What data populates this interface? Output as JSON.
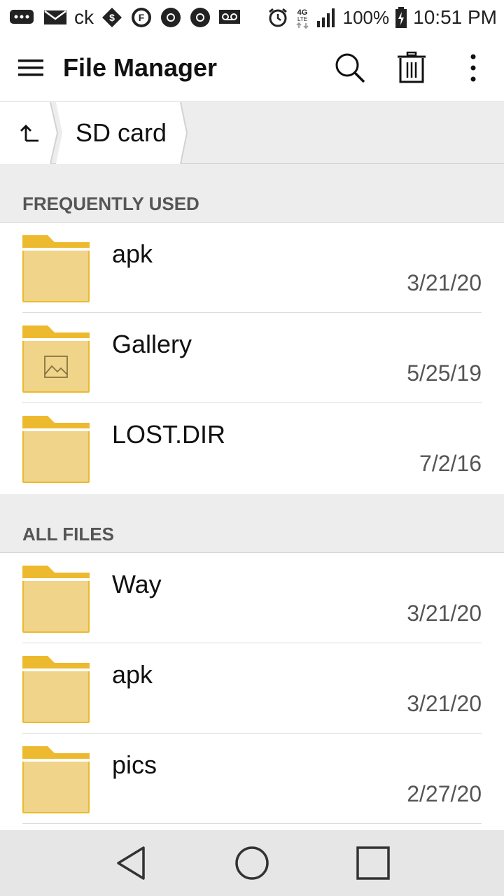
{
  "status_bar": {
    "carrier_text": "ck",
    "battery": "100%",
    "time": "10:51 PM",
    "network_type": "4G LTE",
    "icons": [
      "message-icon",
      "mail-icon",
      "tag-icon",
      "f-badge-icon",
      "chrome-icon",
      "chrome-icon",
      "voicemail-icon",
      "alarm-icon",
      "signal-icon",
      "battery-icon"
    ]
  },
  "app_bar": {
    "title": "File Manager",
    "actions": [
      "search-icon",
      "trash-icon",
      "more-vert-icon"
    ]
  },
  "breadcrumb": {
    "up_icon": "arrow-up-icon",
    "current": "SD card"
  },
  "sections": {
    "frequently_used": {
      "title": "FREQUENTLY USED",
      "items": [
        {
          "name": "apk",
          "date": "3/21/20",
          "icon": "folder-icon"
        },
        {
          "name": "Gallery",
          "date": "5/25/19",
          "icon": "folder-image-icon"
        },
        {
          "name": "LOST.DIR",
          "date": "7/2/16",
          "icon": "folder-icon"
        }
      ]
    },
    "all_files": {
      "title": "ALL FILES",
      "items": [
        {
          "name": "Way",
          "date": "3/21/20",
          "icon": "folder-icon"
        },
        {
          "name": "apk",
          "date": "3/21/20",
          "icon": "folder-icon"
        },
        {
          "name": "pics",
          "date": "2/27/20",
          "icon": "folder-icon"
        }
      ]
    }
  },
  "nav_bar": {
    "buttons": [
      "back-icon",
      "home-icon",
      "recents-icon"
    ]
  },
  "colors": {
    "folder_tab": "#EDB92E",
    "folder_body": "#EFD48A",
    "section_bg": "#EDEDED",
    "nav_bg": "#E6E6E6"
  }
}
